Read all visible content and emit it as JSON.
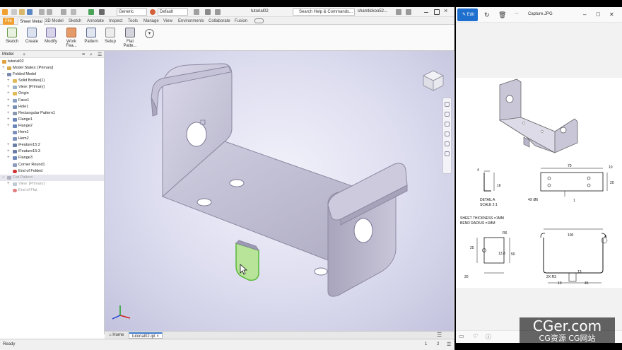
{
  "app": {
    "window_title": "tutorial02",
    "quick_access": {
      "appearance_value": "Generic",
      "material_value": "Default",
      "search_placeholder": "Search Help & Commands...",
      "user_name": "shamtickoo52..."
    },
    "ribbon_tabs": [
      {
        "label": "File"
      },
      {
        "label": "Sheet Metal",
        "active": true
      },
      {
        "label": "3D Model"
      },
      {
        "label": "Sketch"
      },
      {
        "label": "Annotate"
      },
      {
        "label": "Inspect"
      },
      {
        "label": "Tools"
      },
      {
        "label": "Manage"
      },
      {
        "label": "View"
      },
      {
        "label": "Environments"
      },
      {
        "label": "Collaborate"
      },
      {
        "label": "Fusion"
      }
    ],
    "ribbon_groups": [
      {
        "label": "Sketch",
        "icon": "sketch-icon"
      },
      {
        "label": "Create",
        "icon": "create-icon"
      },
      {
        "label": "Modify",
        "icon": "modify-icon"
      },
      {
        "label": "Work Fea...",
        "icon": "work-features-icon"
      },
      {
        "label": "Pattern",
        "icon": "pattern-icon"
      },
      {
        "label": "Setup",
        "icon": "setup-icon"
      },
      {
        "label": "Flat Patte...",
        "icon": "flat-pattern-icon"
      }
    ],
    "browser": {
      "title": "Model",
      "add_label": "+",
      "nodes": [
        {
          "label": "tutorial02",
          "icon": "part-icon"
        },
        {
          "label": "Model States: [Primary]",
          "icon": "model-states-icon"
        },
        {
          "label": "Folded Model",
          "icon": "folded-model-icon"
        },
        {
          "label": "Solid Bodies(1)",
          "icon": "folder-icon"
        },
        {
          "label": "View: [Primary]",
          "icon": "view-icon"
        },
        {
          "label": "Origin",
          "icon": "folder-icon"
        },
        {
          "label": "Face1",
          "icon": "face-icon"
        },
        {
          "label": "Hole1",
          "icon": "hole-icon"
        },
        {
          "label": "Rectangular Pattern1",
          "icon": "pattern-icon"
        },
        {
          "label": "Flange1",
          "icon": "flange-icon"
        },
        {
          "label": "Flange2",
          "icon": "flange-icon"
        },
        {
          "label": "Hem1",
          "icon": "hem-icon"
        },
        {
          "label": "Hem2",
          "icon": "hem-icon"
        },
        {
          "label": "iFeature15:2",
          "icon": "ifeature-icon"
        },
        {
          "label": "iFeature15:3",
          "icon": "ifeature-icon"
        },
        {
          "label": "Flange3",
          "icon": "flange-icon"
        },
        {
          "label": "Corner Round1",
          "icon": "corner-round-icon"
        },
        {
          "label": "End of Folded",
          "icon": "end-of-part-icon"
        },
        {
          "label": "Flat Pattern",
          "icon": "flat-pattern-icon"
        },
        {
          "label": "View: [Primary]",
          "icon": "view-icon"
        },
        {
          "label": "End of Flat",
          "icon": "end-of-part-icon"
        }
      ]
    },
    "document_tabs": {
      "home_label": "Home",
      "file_tab": "tutorial02.ipt"
    },
    "status": {
      "text": "Ready",
      "count_a": "1",
      "count_b": "2"
    }
  },
  "viewer": {
    "edit_label": "Edit",
    "file_name": "Capture.JPG",
    "drawing": {
      "detail_label": "DETAIL A",
      "detail_scale": "SCALE 2:1",
      "thickness_note": "SHEET THICKNESS =1MM",
      "bend_note": "BEND RADIUS =1MM",
      "callout_a": "A",
      "dims": {
        "d4": "4",
        "d16": "16",
        "d70": "70",
        "d10a": "10",
        "d20a": "20",
        "d4x6": "4X Ø6",
        "d1": "1",
        "r6": "R6",
        "d25": "25",
        "d13_8": "13.8",
        "d50": "50",
        "d20b": "20",
        "d100": "100",
        "d2xr3": "2X R3",
        "d13": "13",
        "d10b": "10",
        "d45": "45"
      }
    }
  },
  "watermark": {
    "line1": "CGer.com",
    "line2": "CG资源 CG网站"
  }
}
